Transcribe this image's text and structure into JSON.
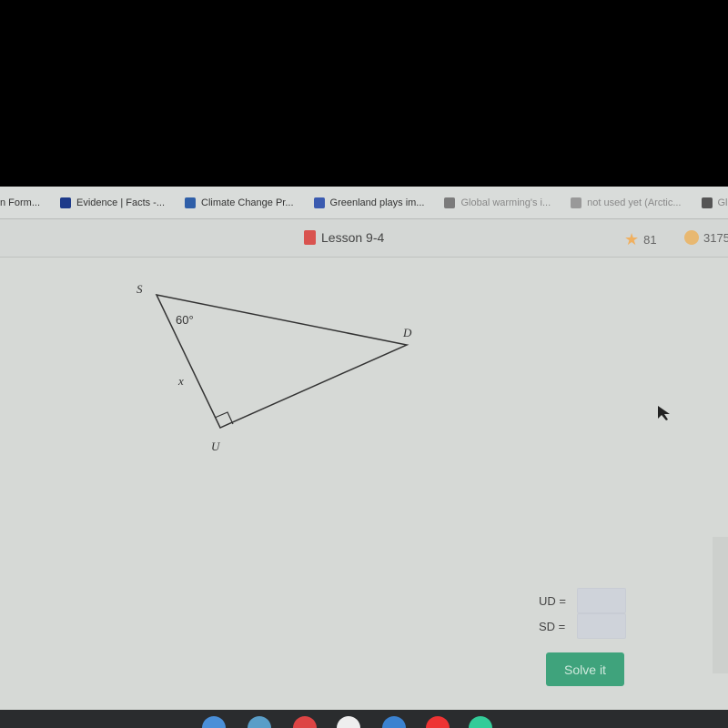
{
  "bookmarks": [
    {
      "label": "n Form...",
      "icon": "form-icon",
      "color": "#d9dcda",
      "faded": false
    },
    {
      "label": "Evidence | Facts -...",
      "icon": "nasa-icon",
      "color": "#1d3a8a",
      "faded": false
    },
    {
      "label": "Climate Change Pr...",
      "icon": "news-icon",
      "color": "#2f5fa8",
      "faded": false
    },
    {
      "label": "Greenland plays im...",
      "icon": "shield-icon",
      "color": "#3b5bb0",
      "faded": false
    },
    {
      "label": "Global warming's i...",
      "icon": "page-icon",
      "color": "#7b7b7b",
      "faded": true
    },
    {
      "label": "not used yet (Arctic...",
      "icon": "flag-icon",
      "color": "#999",
      "faded": true
    },
    {
      "label": "Global sur",
      "icon": "bars-icon",
      "color": "#555",
      "faded": true
    }
  ],
  "header": {
    "title": "Lesson 9-4",
    "stars": "81",
    "coins": "3175"
  },
  "figure": {
    "vertices": {
      "S": "S",
      "D": "D",
      "U": "U"
    },
    "angle_label": "60°",
    "side_label": "x",
    "right_angle_at": "U"
  },
  "answers": [
    {
      "label": "UD =",
      "value": ""
    },
    {
      "label": "SD =",
      "value": ""
    }
  ],
  "solve_label": "Solve it",
  "colors": {
    "accent": "#3fa37c",
    "lesson_icon": "#d9534f",
    "star": "#f0b060"
  }
}
